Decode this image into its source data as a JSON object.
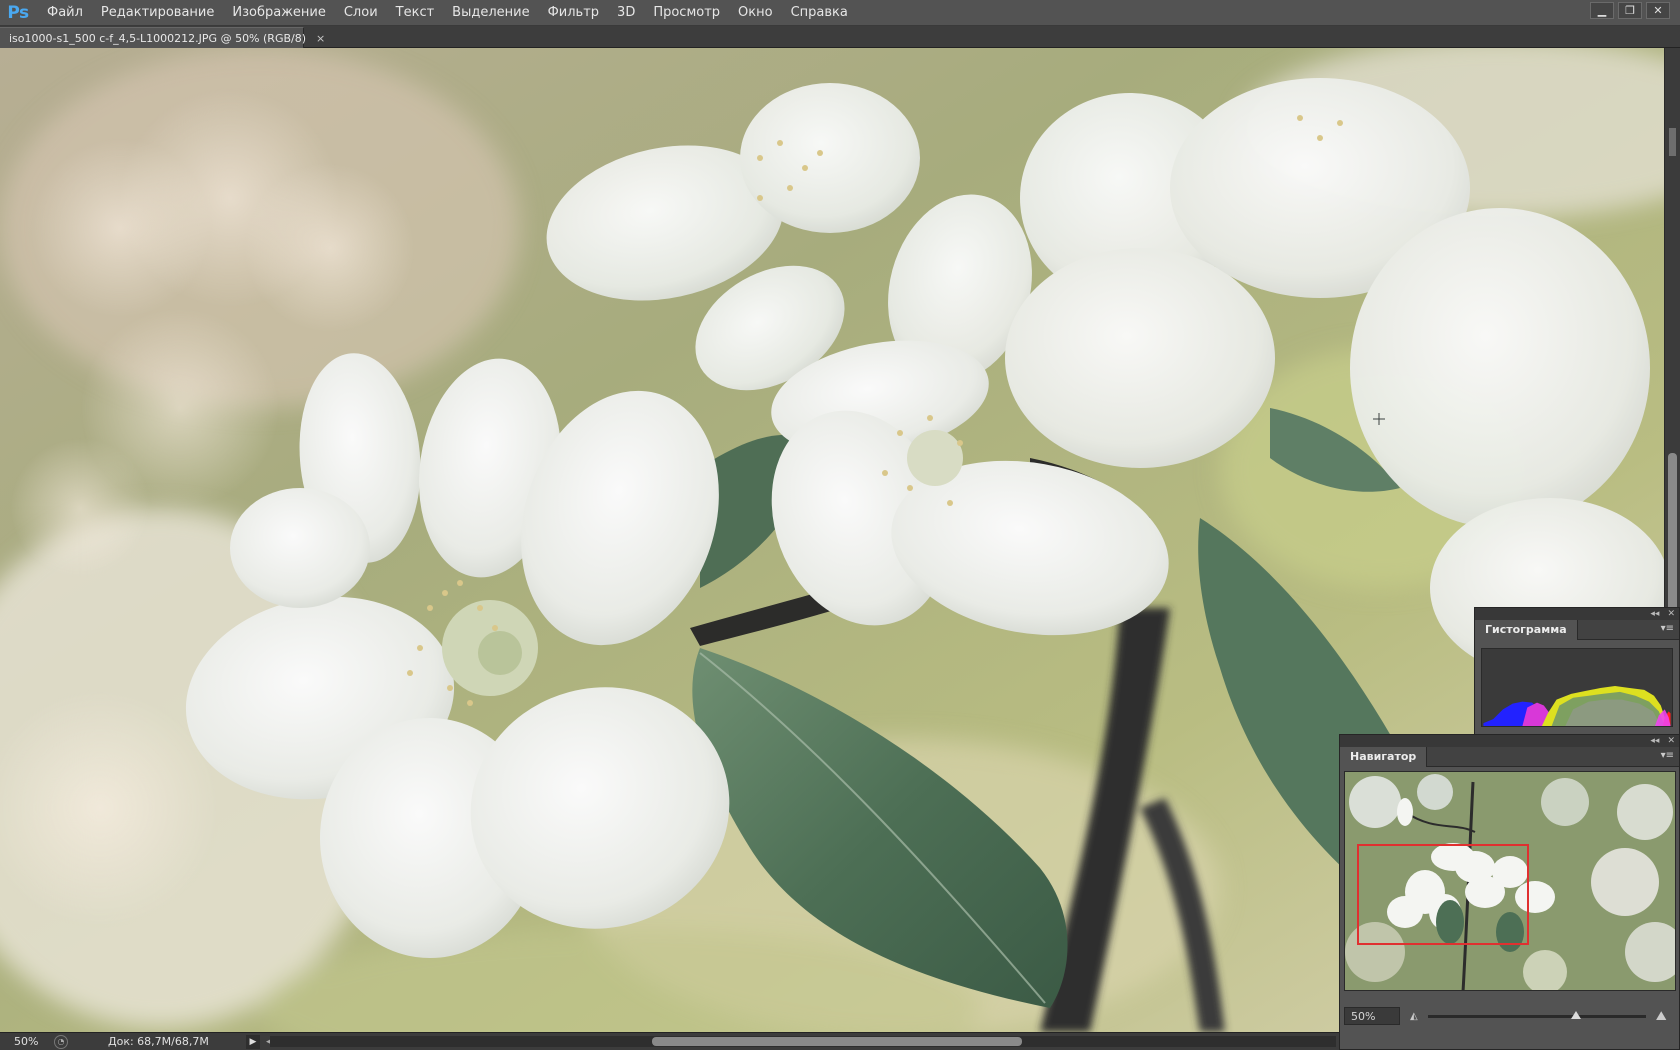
{
  "app": {
    "logo": "Ps"
  },
  "menu": [
    "Файл",
    "Редактирование",
    "Изображение",
    "Слои",
    "Текст",
    "Выделение",
    "Фильтр",
    "3D",
    "Просмотр",
    "Окно",
    "Справка"
  ],
  "window_controls": {
    "minimize": "▁",
    "restore": "❐",
    "close": "✕"
  },
  "document_tab": {
    "title": "iso1000-s1_500 c-f_4,5-L1000212.JPG @ 50% (RGB/8)",
    "close": "×"
  },
  "statusbar": {
    "zoom": "50%",
    "doc_size": "Док: 68,7M/68,7M",
    "menu_arrow": "▶",
    "scroll_left": "◂"
  },
  "histogram_panel": {
    "tab": "Гистограмма",
    "warning_icon": "warning-icon",
    "warning_glyph": "⚠"
  },
  "navigator_panel": {
    "tab": "Навигатор",
    "zoom": "50%",
    "zoom_level": 0.68
  },
  "panel_controls": {
    "collapse": "◂◂",
    "close": "✕",
    "menu": "▾≡"
  },
  "colors": {
    "menubar": "#535353",
    "panel": "#535353",
    "accent_logo": "#4aa8f0",
    "nav_view_frame": "#e03030"
  }
}
